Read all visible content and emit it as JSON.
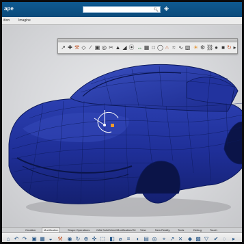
{
  "app": {
    "title": "ape",
    "search_placeholder": "",
    "search_icon": "search-icon",
    "tag_icon": "tag-icon"
  },
  "tabs": [
    {
      "label": "ition"
    },
    {
      "label": "Imagine"
    }
  ],
  "floating_toolbar": {
    "label": "",
    "icon_count": 27
  },
  "bottom_tabs": [
    {
      "label": "Creation",
      "active": false
    },
    {
      "label": "Modification",
      "active": true
    },
    {
      "label": "Shape Operations",
      "active": false
    },
    {
      "label": "CAA Solid Mesh/Modification/Gil",
      "active": false
    },
    {
      "label": "View",
      "active": false
    },
    {
      "label": "New Reality",
      "active": false
    },
    {
      "label": "Tools",
      "active": false
    },
    {
      "label": "Debug",
      "active": false
    },
    {
      "label": "Touch",
      "active": false
    }
  ],
  "colors": {
    "titlebar": "#0f5a92",
    "car_body": "#1d2f9a",
    "mesh_lines": "#0d1a5c"
  }
}
